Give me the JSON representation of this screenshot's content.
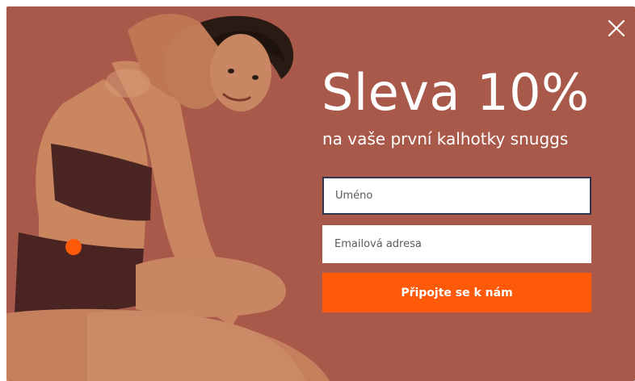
{
  "popup": {
    "headline": "Sleva 10%",
    "subtitle": "na vaše první kalhotky snuggs",
    "close_icon": "close-icon",
    "form": {
      "name_placeholder": "Uméno",
      "email_placeholder": "Emailová adresa",
      "submit_label": "Připojte se k nám"
    },
    "photo": "woman-in-underwear-photo"
  },
  "colors": {
    "background": "#a8594a",
    "accent": "#ff5a0a",
    "text": "#ffffff",
    "focus_border": "#2e3550"
  }
}
